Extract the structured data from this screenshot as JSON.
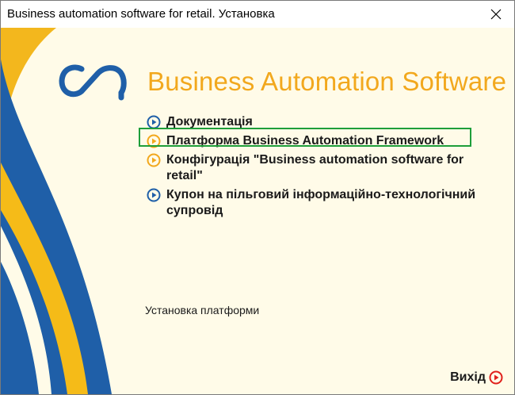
{
  "window": {
    "title": "Business automation software for retail. Установка"
  },
  "brand": {
    "name": "Business Automation Software",
    "accent_color": "#f2a81d",
    "primary_color": "#1f5fa8"
  },
  "menu": {
    "items": [
      {
        "label": "Документація",
        "bullet_icon": "blue-play-bullet-icon"
      },
      {
        "label": "Платформа Business Automation Framework",
        "bullet_icon": "orange-play-bullet-icon",
        "selected": true
      },
      {
        "label": "Конфігурація \"Business automation software for retail\"",
        "bullet_icon": "orange-play-bullet-icon"
      },
      {
        "label": "Купон на пільговий інформаційно-технологічний супровід",
        "bullet_icon": "blue-play-bullet-icon"
      }
    ]
  },
  "status": {
    "text": "Установка платформи"
  },
  "footer": {
    "exit_label": "Вихід",
    "exit_icon": "red-play-circle-icon"
  }
}
